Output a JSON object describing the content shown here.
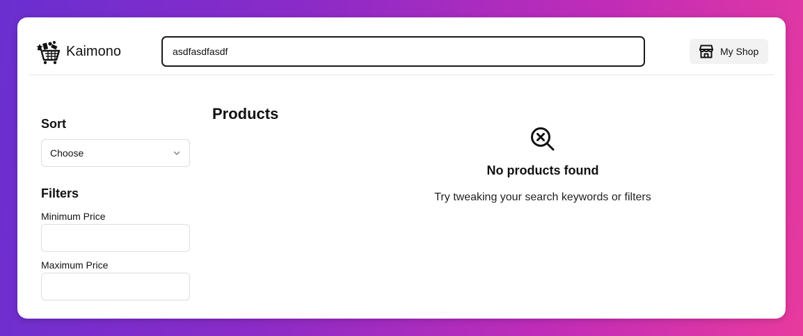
{
  "header": {
    "brand": "Kaimono",
    "search_value": "asdfasdfasdf",
    "shop_button_label": "My Shop",
    "shop_icon": "store-icon",
    "logo_icon": "shopping-cart-logo"
  },
  "sidebar": {
    "sort_title": "Sort",
    "sort_select_value": "Choose",
    "filters_title": "Filters",
    "min_price_label": "Minimum Price",
    "min_price_value": "",
    "max_price_label": "Maximum Price",
    "max_price_value": ""
  },
  "main": {
    "title": "Products",
    "empty_icon": "search-x-icon",
    "empty_title": "No products found",
    "empty_subtitle": "Try tweaking your search keywords or filters"
  }
}
